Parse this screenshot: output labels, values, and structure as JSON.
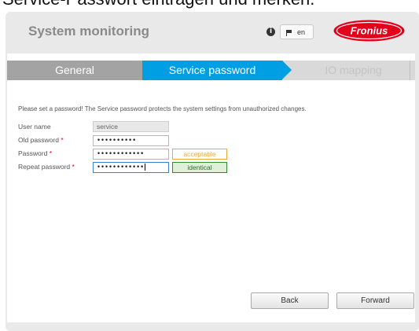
{
  "caption": "Service-Passwort eintragen und merken.",
  "header": {
    "title": "System monitoring",
    "info_icon": "i",
    "language": "en",
    "logo_text": "Fronius",
    "colors": {
      "logo_red": "#e2001a",
      "accent_blue": "#009fe3"
    }
  },
  "tabs": [
    {
      "label": "General",
      "state": "done"
    },
    {
      "label": "Service password",
      "state": "active"
    },
    {
      "label": "IO mapping",
      "state": "disabled"
    }
  ],
  "form": {
    "intro": "Please set a password! The Service password protects the system settings from unauthorized changes.",
    "required_mark": "*",
    "username": {
      "label": "User name",
      "value": "service"
    },
    "old_password": {
      "label": "Old password",
      "value": "••••••••••"
    },
    "password": {
      "label": "Password",
      "value": "••••••••••••",
      "strength": "acceptable"
    },
    "repeat_password": {
      "label": "Repeat password",
      "value": "••••••••••••",
      "match": "identical"
    }
  },
  "buttons": {
    "back": "Back",
    "forward": "Forward"
  }
}
